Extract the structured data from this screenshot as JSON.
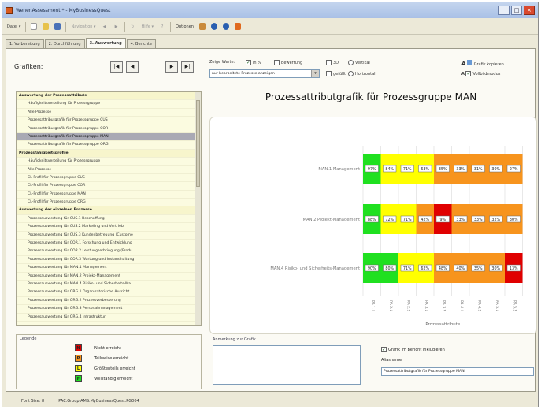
{
  "window": {
    "title": "WenenAssessment * - MyBusinessQuest",
    "min_btn": "_",
    "max_btn": "□",
    "close_btn": "×"
  },
  "toolbar": {
    "datei": "Datei ▾",
    "navigation": "Navigation ▾",
    "hilfe": "Hilfe ▾",
    "optionen": "Optionen"
  },
  "tabs": [
    {
      "label": "1. Vorbereitung"
    },
    {
      "label": "2. Durchführung"
    },
    {
      "label": "3. Auswertung"
    },
    {
      "label": "4. Berichte"
    }
  ],
  "left": {
    "grafiken_label": "Grafiken:",
    "nav": [
      "|◀",
      "◀",
      "▶",
      "▶|"
    ],
    "list": [
      {
        "label": "Auswertung der Prozessattribute",
        "kind": "hdr"
      },
      {
        "label": "Häufigkeitsverteilung für Prozessgruppe",
        "kind": ""
      },
      {
        "label": "Alle Prozesse",
        "kind": ""
      },
      {
        "label": "Prozessattributgrafik für Prozessgruppe CUS",
        "kind": ""
      },
      {
        "label": "Prozessattributgrafik für Prozessgruppe COR",
        "kind": ""
      },
      {
        "label": "Prozessattributgrafik für Prozessgruppe MAN",
        "kind": "sel"
      },
      {
        "label": "Prozessattributgrafik für Prozessgruppe ORG",
        "kind": ""
      },
      {
        "label": "Prozessfähigkeitsprofile",
        "kind": "hdr"
      },
      {
        "label": "Häufigkeitsverteilung für Prozessgruppe",
        "kind": ""
      },
      {
        "label": "Alle Prozesse",
        "kind": ""
      },
      {
        "label": "CL-Profil für Prozessgruppe CUS",
        "kind": ""
      },
      {
        "label": "CL-Profil für Prozessgruppe COR",
        "kind": ""
      },
      {
        "label": "CL-Profil für Prozessgruppe MAN",
        "kind": ""
      },
      {
        "label": "CL-Profil für Prozessgruppe ORG",
        "kind": ""
      },
      {
        "label": "Auswertung der einzelnen Prozesse",
        "kind": "hdr"
      },
      {
        "label": "Prozessauswertung für CUS.1 Beschaffung",
        "kind": ""
      },
      {
        "label": "Prozessauswertung für CUS.2 Marketing und Vertrieb",
        "kind": ""
      },
      {
        "label": "Prozessauswertung für CUS.3 Kundenbetreuung (Custome",
        "kind": ""
      },
      {
        "label": "Prozessauswertung für COR.1 Forschung und Entwicklung",
        "kind": ""
      },
      {
        "label": "Prozessauswertung für COR.2 Leistungserbringung (Produ",
        "kind": ""
      },
      {
        "label": "Prozessauswertung für COR.3 Wartung und Instandhaltung",
        "kind": ""
      },
      {
        "label": "Prozessauswertung für MAN.1 Management",
        "kind": ""
      },
      {
        "label": "Prozessauswertung für MAN.2 Projekt-Management",
        "kind": ""
      },
      {
        "label": "Prozessauswertung für MAN.4 Risiko- und Sicherheits-Ma",
        "kind": ""
      },
      {
        "label": "Prozessauswertung für ORG.1 Organisatorische Ausricht",
        "kind": ""
      },
      {
        "label": "Prozessauswertung für ORG.2 Prozessverbesserung",
        "kind": ""
      },
      {
        "label": "Prozessauswertung für ORG.3 Personalmanagement",
        "kind": ""
      },
      {
        "label": "Prozessauswertung für ORG.4 Infrastruktur",
        "kind": ""
      }
    ]
  },
  "legend": {
    "title": "Legende",
    "items": [
      {
        "symbol": "N",
        "label": "Nicht erreicht",
        "color": "#e00000"
      },
      {
        "symbol": "P",
        "label": "Teilweise erreicht",
        "color": "#f7941d"
      },
      {
        "symbol": "L",
        "label": "Größtenteils erreicht",
        "color": "#ffff00"
      },
      {
        "symbol": "F",
        "label": "Vollständig erreicht",
        "color": "#20e020"
      }
    ]
  },
  "options": {
    "zeige_werte": "Zeige Werte:",
    "in_prozent": "in %",
    "bewertung": "Bewertung",
    "d3": "3D",
    "vertikal": "Vertikal",
    "gefuellt": "gefüllt",
    "horizontal": "Horizontal",
    "filter_select": "nur bearbeitete Prozesse anzeigen",
    "grafik_kopieren": "Grafik kopieren",
    "vollbildmodus": "Vollbildmodus"
  },
  "chart_title": "Prozessattributgrafik für Prozessgruppe MAN",
  "chart_data": {
    "type": "heatmap",
    "title": "Prozessattributgrafik für Prozessgruppe MAN",
    "xlabel": "Prozessattribute",
    "ylabel": "",
    "categories": [
      "PA 1.1",
      "PA 2.1",
      "PA 2.2",
      "PA 3.1",
      "PA 3.2",
      "PA 4.1",
      "PA 4.2",
      "PA 5.1",
      "PA 5.2"
    ],
    "rows": [
      {
        "name": "MAN.1 Management",
        "values": [
          97,
          84,
          71,
          63,
          35,
          33,
          31,
          30,
          27
        ],
        "colors": [
          "#20e020",
          "#ffff00",
          "#ffff00",
          "#ffff00",
          "#f7941d",
          "#f7941d",
          "#f7941d",
          "#f7941d",
          "#f7941d"
        ]
      },
      {
        "name": "MAN.2 Projekt-Management",
        "values": [
          88,
          72,
          71,
          42,
          9,
          33,
          33,
          32,
          30
        ],
        "colors": [
          "#20e020",
          "#ffff00",
          "#ffff00",
          "#f7941d",
          "#e00000",
          "#f7941d",
          "#f7941d",
          "#f7941d",
          "#f7941d"
        ]
      },
      {
        "name": "MAN.4 Risiko- und Sicherheits-Management",
        "values": [
          90,
          80,
          71,
          62,
          48,
          40,
          35,
          30,
          13
        ],
        "colors": [
          "#20e020",
          "#20e020",
          "#ffff00",
          "#ffff00",
          "#f7941d",
          "#f7941d",
          "#f7941d",
          "#f7941d",
          "#e00000"
        ]
      }
    ],
    "value_suffix": "%",
    "grid": true
  },
  "bottom": {
    "anmerkung_label": "Anmerkung zur Grafik",
    "anmerkung_value": "",
    "im_bericht": "Grafik im Bericht inkludieren",
    "aliasname_label": "Aliasname",
    "aliasname_value": "Prozessattributgrafik für Prozessgruppe MAN"
  },
  "status": {
    "font_size": "Font Size: 8",
    "path": "PAC.Group.AMS.MyBusinessQuest.PG004"
  }
}
